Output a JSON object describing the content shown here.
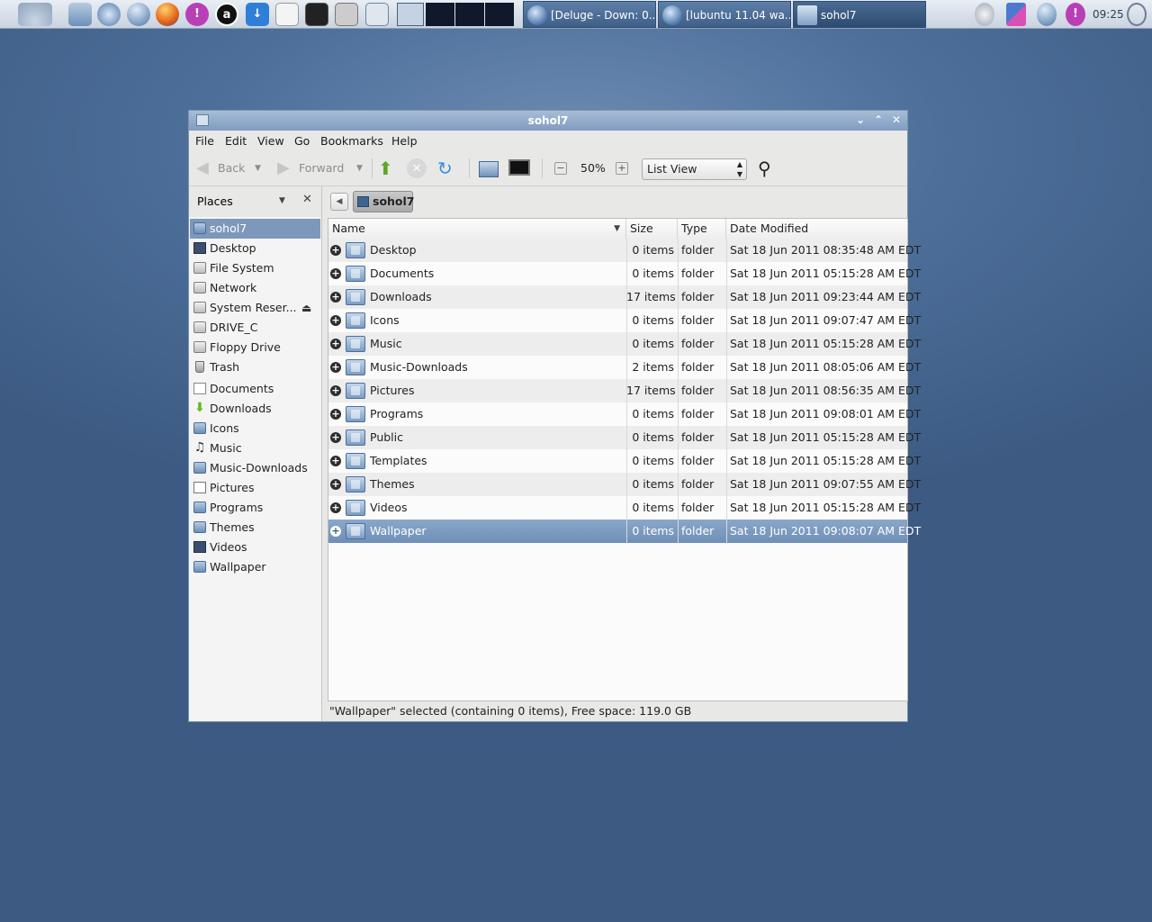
{
  "taskbar": {
    "tasks": [
      {
        "label": "[Deluge - Down: 0...",
        "active": false
      },
      {
        "label": "[lubuntu 11.04 wa...",
        "active": false
      },
      {
        "label": "sohol7",
        "active": true
      }
    ],
    "clock": "09:25"
  },
  "window": {
    "title": "sohol7",
    "menu": [
      "File",
      "Edit",
      "View",
      "Go",
      "Bookmarks",
      "Help"
    ],
    "toolbar": {
      "back_label": "Back",
      "forward_label": "Forward",
      "zoom": "50%",
      "view_mode": "List View"
    },
    "sidebar": {
      "title": "Places",
      "places": [
        {
          "label": "sohol7",
          "icon": "home-icon",
          "selected": true
        },
        {
          "label": "Desktop",
          "icon": "desktop-icon"
        },
        {
          "label": "File System",
          "icon": "drive-icon"
        },
        {
          "label": "Network",
          "icon": "network-icon"
        },
        {
          "label": "System Reser...",
          "icon": "drive-icon",
          "eject": true
        },
        {
          "label": "DRIVE_C",
          "icon": "drive-icon"
        },
        {
          "label": "Floppy Drive",
          "icon": "floppy-icon"
        },
        {
          "label": "Trash",
          "icon": "trash-icon"
        }
      ],
      "bookmarks": [
        {
          "label": "Documents",
          "icon": "documents-icon"
        },
        {
          "label": "Downloads",
          "icon": "downloads-icon"
        },
        {
          "label": "Icons",
          "icon": "folder-icon"
        },
        {
          "label": "Music",
          "icon": "music-icon"
        },
        {
          "label": "Music-Downloads",
          "icon": "folder-icon"
        },
        {
          "label": "Pictures",
          "icon": "pictures-icon"
        },
        {
          "label": "Programs",
          "icon": "folder-icon"
        },
        {
          "label": "Themes",
          "icon": "folder-icon"
        },
        {
          "label": "Videos",
          "icon": "video-icon"
        },
        {
          "label": "Wallpaper",
          "icon": "folder-icon"
        }
      ]
    },
    "breadcrumb": "sohol7",
    "columns": {
      "name": "Name",
      "size": "Size",
      "type": "Type",
      "date": "Date Modified"
    },
    "files": [
      {
        "name": "Desktop",
        "size": "0 items",
        "type": "folder",
        "date": "Sat 18 Jun 2011 08:35:48 AM EDT"
      },
      {
        "name": "Documents",
        "size": "0 items",
        "type": "folder",
        "date": "Sat 18 Jun 2011 05:15:28 AM EDT"
      },
      {
        "name": "Downloads",
        "size": "17 items",
        "type": "folder",
        "date": "Sat 18 Jun 2011 09:23:44 AM EDT"
      },
      {
        "name": "Icons",
        "size": "0 items",
        "type": "folder",
        "date": "Sat 18 Jun 2011 09:07:47 AM EDT"
      },
      {
        "name": "Music",
        "size": "0 items",
        "type": "folder",
        "date": "Sat 18 Jun 2011 05:15:28 AM EDT"
      },
      {
        "name": "Music-Downloads",
        "size": "2 items",
        "type": "folder",
        "date": "Sat 18 Jun 2011 08:05:06 AM EDT"
      },
      {
        "name": "Pictures",
        "size": "17 items",
        "type": "folder",
        "date": "Sat 18 Jun 2011 08:56:35 AM EDT"
      },
      {
        "name": "Programs",
        "size": "0 items",
        "type": "folder",
        "date": "Sat 18 Jun 2011 09:08:01 AM EDT"
      },
      {
        "name": "Public",
        "size": "0 items",
        "type": "folder",
        "date": "Sat 18 Jun 2011 05:15:28 AM EDT"
      },
      {
        "name": "Templates",
        "size": "0 items",
        "type": "folder",
        "date": "Sat 18 Jun 2011 05:15:28 AM EDT"
      },
      {
        "name": "Themes",
        "size": "0 items",
        "type": "folder",
        "date": "Sat 18 Jun 2011 09:07:55 AM EDT"
      },
      {
        "name": "Videos",
        "size": "0 items",
        "type": "folder",
        "date": "Sat 18 Jun 2011 05:15:28 AM EDT"
      },
      {
        "name": "Wallpaper",
        "size": "0 items",
        "type": "folder",
        "date": "Sat 18 Jun 2011 09:08:07 AM EDT",
        "selected": true
      }
    ],
    "status": "\"Wallpaper\" selected (containing 0 items), Free space: 119.0 GB"
  },
  "colors": {
    "accent": "#7d98bb",
    "selected_row": "#7b9ac0",
    "desktop": "#4d6f9a"
  }
}
